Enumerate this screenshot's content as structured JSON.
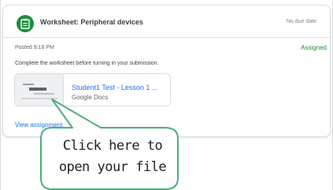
{
  "assignment": {
    "title": "Worksheet: Peripheral devices",
    "due": "No due date",
    "posted": "Posted 9:18 PM",
    "status": "Assigned",
    "status_color": "#1e8e3e",
    "instructions": "Complete the worksheet before turning in your submission.",
    "icon": "assignment-icon",
    "view_link": "View assignment"
  },
  "attachment": {
    "title": "Student1 Test - Lesson 1 ...",
    "type": "Google Docs",
    "thumbnail_label": "Learning",
    "link_color": "#1a73e8"
  },
  "callout": {
    "line1": "Click here to",
    "line2": "open your file",
    "border_color": "#4caf7a"
  }
}
